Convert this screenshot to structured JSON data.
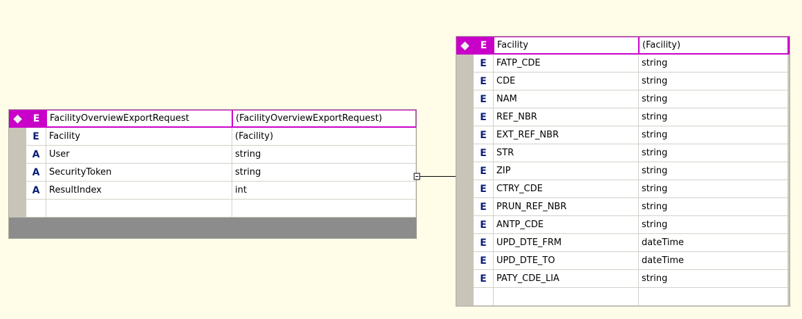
{
  "left_table": {
    "name": "FacilityOverviewExportRequest",
    "type": "(FacilityOverviewExportRequest)",
    "header_kind": "E",
    "rows": [
      {
        "kind": "E",
        "name": "Facility",
        "type": "(Facility)"
      },
      {
        "kind": "A",
        "name": "User",
        "type": "string"
      },
      {
        "kind": "A",
        "name": "SecurityToken",
        "type": "string"
      },
      {
        "kind": "A",
        "name": "ResultIndex",
        "type": "int"
      }
    ]
  },
  "right_table": {
    "name": "Facility",
    "type": "(Facility)",
    "header_kind": "E",
    "rows": [
      {
        "kind": "E",
        "name": "FATP_CDE",
        "type": "string"
      },
      {
        "kind": "E",
        "name": "CDE",
        "type": "string"
      },
      {
        "kind": "E",
        "name": "NAM",
        "type": "string"
      },
      {
        "kind": "E",
        "name": "REF_NBR",
        "type": "string"
      },
      {
        "kind": "E",
        "name": "EXT_REF_NBR",
        "type": "string"
      },
      {
        "kind": "E",
        "name": "STR",
        "type": "string"
      },
      {
        "kind": "E",
        "name": "ZIP",
        "type": "string"
      },
      {
        "kind": "E",
        "name": "CTRY_CDE",
        "type": "string"
      },
      {
        "kind": "E",
        "name": "PRUN_REF_NBR",
        "type": "string"
      },
      {
        "kind": "E",
        "name": "ANTP_CDE",
        "type": "string"
      },
      {
        "kind": "E",
        "name": "UPD_DTE_FRM",
        "type": "dateTime"
      },
      {
        "kind": "E",
        "name": "UPD_DTE_TO",
        "type": "dateTime"
      },
      {
        "kind": "E",
        "name": "PATY_CDE_LIA",
        "type": "string"
      }
    ]
  },
  "colors": {
    "header": "#c800c8",
    "background": "#fffde8",
    "element_letter": "#0a1e78"
  }
}
